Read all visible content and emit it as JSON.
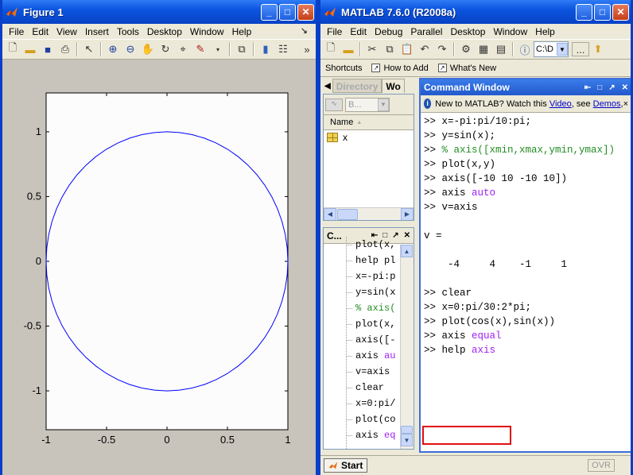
{
  "figure_window": {
    "title": "Figure 1",
    "menu": [
      "File",
      "Edit",
      "View",
      "Insert",
      "Tools",
      "Desktop",
      "Window",
      "Help"
    ],
    "dock_arrow": "↘",
    "toolbar_overflow": "»",
    "plot": {
      "x_ticks": [
        "-1",
        "-0.5",
        "0",
        "0.5",
        "1"
      ],
      "y_ticks": [
        "1",
        "0.5",
        "0",
        "-0.5",
        "-1"
      ],
      "line_color": "#0000ff",
      "chart_data": {
        "type": "line",
        "series": [
          {
            "equation": "x = cos(t), y = sin(t), t = 0:pi/30:2*pi"
          }
        ],
        "xlim": [
          -1,
          1
        ],
        "ylim": [
          -1.3,
          1.3
        ],
        "axis": "equal"
      }
    }
  },
  "matlab_window": {
    "title": "MATLAB  7.6.0 (R2008a)",
    "menu": [
      "File",
      "Edit",
      "Debug",
      "Parallel",
      "Desktop",
      "Window",
      "Help"
    ],
    "current_directory": "C:\\D",
    "browse_button": "...",
    "shortcuts": {
      "label": "Shortcuts",
      "items": [
        "How to Add",
        "What's New"
      ]
    },
    "left_tabs": [
      "Directory",
      "Wo"
    ],
    "workspace": {
      "filter_value": "B...",
      "column_header": "Name",
      "sort_arrow": "▲",
      "variables": [
        "x"
      ]
    },
    "command_history": {
      "title": "C...",
      "lines": [
        "plot(x,",
        "help pl",
        "x=-pi:p",
        "y=sin(x",
        "% axis(",
        "plot(x,",
        "axis([-",
        "axis au",
        "v=axis",
        "clear",
        "x=0:pi/",
        "plot(co",
        "axis eq"
      ]
    },
    "command_window": {
      "title": "Command Window",
      "new_bar": {
        "prefix": "New to MATLAB? Watch this ",
        "video_link": "Video",
        "middle": ", see ",
        "demos_link": "Demos",
        "suffix": ","
      },
      "close_x": "×",
      "lines": [
        {
          "text": ">> x=-pi:pi/10:pi;"
        },
        {
          "text": ">> y=sin(x);"
        },
        {
          "prefix": ">> ",
          "comment": "% axis([xmin,xmax,ymin,ymax])"
        },
        {
          "text": ">> plot(x,y)"
        },
        {
          "text": ">> axis([-10 10 -10 10])"
        },
        {
          "prefix": ">> axis ",
          "keyword": "auto"
        },
        {
          "text": ">> v=axis"
        },
        {
          "text": ""
        },
        {
          "text": "v ="
        },
        {
          "text": ""
        },
        {
          "text": "    -4     4    -1     1"
        },
        {
          "text": ""
        },
        {
          "text": ">> clear"
        },
        {
          "text": ">> x=0:pi/30:2*pi;"
        },
        {
          "text": ">> plot(cos(x),sin(x))"
        },
        {
          "prefix": ">> axis ",
          "keyword": "equal"
        },
        {
          "prefix": ">> help ",
          "keyword": "axis"
        }
      ]
    },
    "start_button": "Start",
    "status_ovr": "OVR"
  }
}
